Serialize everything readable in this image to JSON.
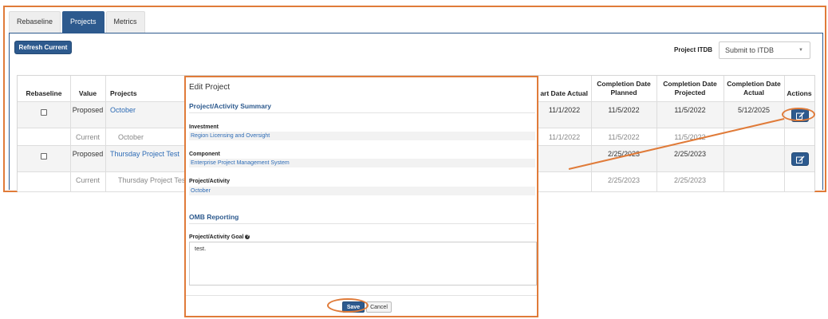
{
  "tabs": [
    {
      "label": "Rebaseline",
      "active": false
    },
    {
      "label": "Projects",
      "active": true
    },
    {
      "label": "Metrics",
      "active": false
    }
  ],
  "toolbar": {
    "refresh_label": "Refresh Current",
    "itdb_label": "Project ITDB",
    "itdb_value": "Submit to ITDB"
  },
  "table": {
    "headers": {
      "rebaseline": "Rebaseline",
      "value": "Value",
      "projects": "Projects",
      "start_actual": "art Date Actual",
      "completion_planned": "Completion Date Planned",
      "completion_projected": "Completion Date Projected",
      "completion_actual": "Completion Date Actual",
      "actions": "Actions"
    },
    "rows": [
      {
        "value": "Proposed",
        "project": "October",
        "start_actual": "11/1/2022",
        "completion_planned": "11/5/2022",
        "completion_projected": "11/5/2022",
        "completion_actual": "5/12/2025"
      },
      {
        "value": "Current",
        "project": "October",
        "start_actual": "11/1/2022",
        "completion_planned": "11/5/2022",
        "completion_projected": "11/5/2022",
        "completion_actual": ""
      },
      {
        "value": "Proposed",
        "project": "Thursday Project Test",
        "start_actual": "",
        "completion_planned": "2/25/2023",
        "completion_projected": "2/25/2023",
        "completion_actual": ""
      },
      {
        "value": "Current",
        "project": "Thursday Project Test",
        "start_actual": "",
        "completion_planned": "2/25/2023",
        "completion_projected": "2/25/2023",
        "completion_actual": ""
      }
    ]
  },
  "modal": {
    "title": "Edit Project",
    "summary_heading": "Project/Activity Summary",
    "investment_label": "Investment",
    "investment_value": "Region Licensing and Oversight",
    "component_label": "Component",
    "component_value": "Enterprise Project Management System",
    "activity_label": "Project/Activity",
    "activity_value": "October",
    "omb_heading": "OMB Reporting",
    "goal_label": "Project/Activity Goal",
    "goal_value": "test.",
    "save_label": "Save",
    "cancel_label": "Cancel"
  },
  "colors": {
    "primary": "#2d5a8e",
    "link": "#2d6bb5",
    "annotation": "#e07b39"
  },
  "icons": {
    "edit": "edit-icon",
    "info": "info-icon",
    "dropdown": "chevron-down-icon"
  }
}
